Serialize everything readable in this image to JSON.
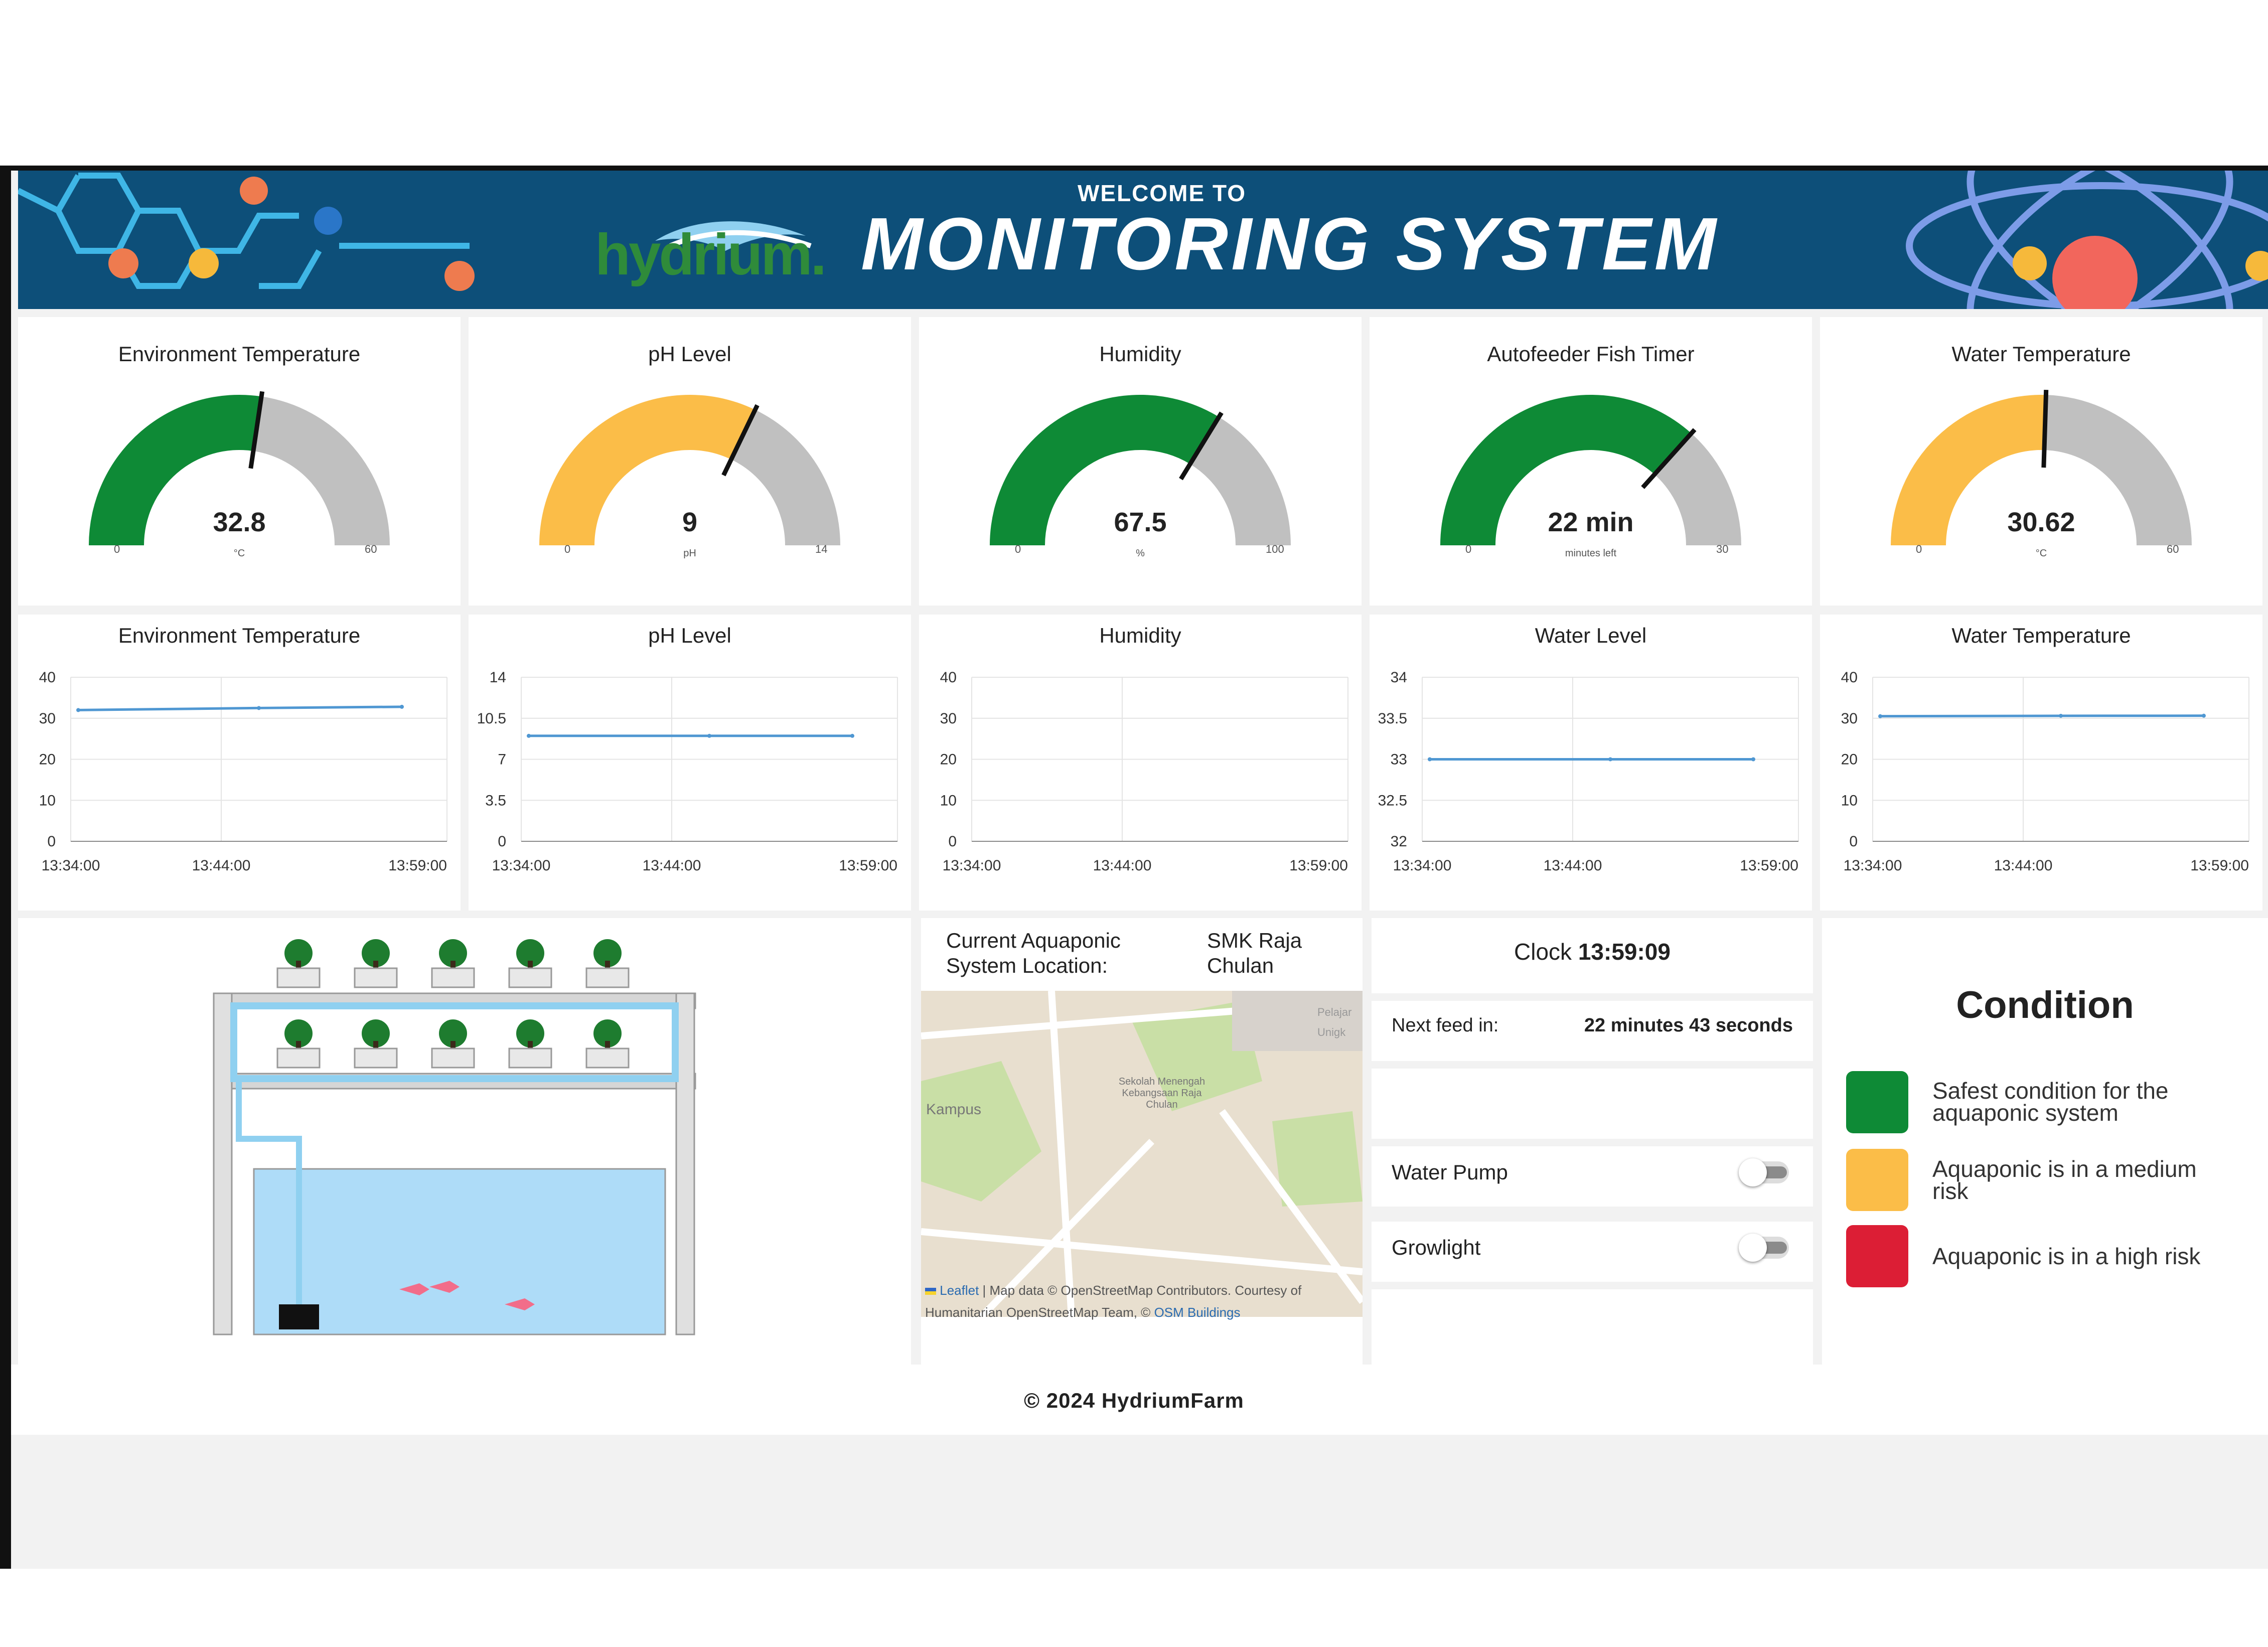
{
  "header": {
    "welcome": "WELCOME TO",
    "logo_text": "hydrium.",
    "title": "MONITORING SYSTEM"
  },
  "gauges": [
    {
      "title": "Environment Temperature",
      "value": "32.8",
      "unit": "°C",
      "min": "0",
      "max": "60",
      "fraction": 0.547,
      "color": "#0e8a36"
    },
    {
      "title": "pH Level",
      "value": "9",
      "unit": "pH",
      "min": "0",
      "max": "14",
      "fraction": 0.643,
      "color": "#fbbd48"
    },
    {
      "title": "Humidity",
      "value": "67.5",
      "unit": "%",
      "min": "0",
      "max": "100",
      "fraction": 0.675,
      "color": "#0e8a36"
    },
    {
      "title": "Autofeeder Fish Timer",
      "value": "22 min",
      "unit": "minutes left",
      "min": "0",
      "max": "30",
      "fraction": 0.733,
      "color": "#0e8a36"
    },
    {
      "title": "Water Temperature",
      "value": "30.62",
      "unit": "°C",
      "min": "0",
      "max": "60",
      "fraction": 0.51,
      "color": "#fbbd48"
    }
  ],
  "chart_data": [
    {
      "type": "line",
      "title": "Environment Temperature",
      "x_ticks": [
        "13:34:00",
        "13:44:00",
        "13:59:00"
      ],
      "y_ticks": [
        "0",
        "10",
        "20",
        "30",
        "40"
      ],
      "ylim": [
        0,
        40
      ],
      "series": [
        {
          "values": [
            32,
            32.5,
            32.8
          ]
        }
      ],
      "grid": true
    },
    {
      "type": "line",
      "title": "pH Level",
      "x_ticks": [
        "13:34:00",
        "13:44:00",
        "13:59:00"
      ],
      "y_ticks": [
        "0",
        "3.5",
        "7",
        "10.5",
        "14"
      ],
      "ylim": [
        0,
        14
      ],
      "series": [
        {
          "values": [
            9,
            9,
            9
          ]
        }
      ],
      "grid": true
    },
    {
      "type": "line",
      "title": "Humidity",
      "x_ticks": [
        "13:34:00",
        "13:44:00",
        "13:59:00"
      ],
      "y_ticks": [
        "0",
        "10",
        "20",
        "30",
        "40"
      ],
      "ylim": [
        0,
        40
      ],
      "series": [],
      "grid": true
    },
    {
      "type": "line",
      "title": "Water Level",
      "x_ticks": [
        "13:34:00",
        "13:44:00",
        "13:59:00"
      ],
      "y_ticks": [
        "32",
        "32.5",
        "33",
        "33.5",
        "34"
      ],
      "ylim": [
        32,
        34
      ],
      "series": [
        {
          "values": [
            33,
            33,
            33
          ]
        }
      ],
      "grid": true
    },
    {
      "type": "line",
      "title": "Water Temperature",
      "x_ticks": [
        "13:34:00",
        "13:44:00",
        "13:59:00"
      ],
      "y_ticks": [
        "0",
        "10",
        "20",
        "30",
        "40"
      ],
      "ylim": [
        0,
        40
      ],
      "series": [
        {
          "values": [
            30.5,
            30.6,
            30.62
          ]
        }
      ],
      "grid": true
    }
  ],
  "location": {
    "label": "Current Aquaponic System Location:",
    "value": "SMK Raja Chulan",
    "map_labels": [
      "Kampus",
      "Sekolah Menengah Kebangsaan Raja Chulan",
      "Pelajar",
      "Unigk"
    ],
    "attribution_link": "Leaflet",
    "attribution_text": " | Map data © OpenStreetMap Contributors. Courtesy of Humanitarian OpenStreetMap Team, © ",
    "attribution_osm": "OSM Buildings"
  },
  "controls": {
    "clock_label": "Clock",
    "clock_value": "13:59:09",
    "feed_label": "Next feed in:",
    "feed_value": "22 minutes 43 seconds",
    "water_pump_label": "Water Pump",
    "water_pump_on": false,
    "growlight_label": "Growlight",
    "growlight_on": false
  },
  "condition": {
    "title": "Condition",
    "items": [
      {
        "color": "#0e8a36",
        "text": "Safest condition for the aquaponic system"
      },
      {
        "color": "#fbbd48",
        "text": "Aquaponic is in a medium risk"
      },
      {
        "color": "#dc1e35",
        "text": "Aquaponic is in a high risk"
      }
    ]
  },
  "footer": {
    "text": "© 2024 HydriumFarm"
  }
}
